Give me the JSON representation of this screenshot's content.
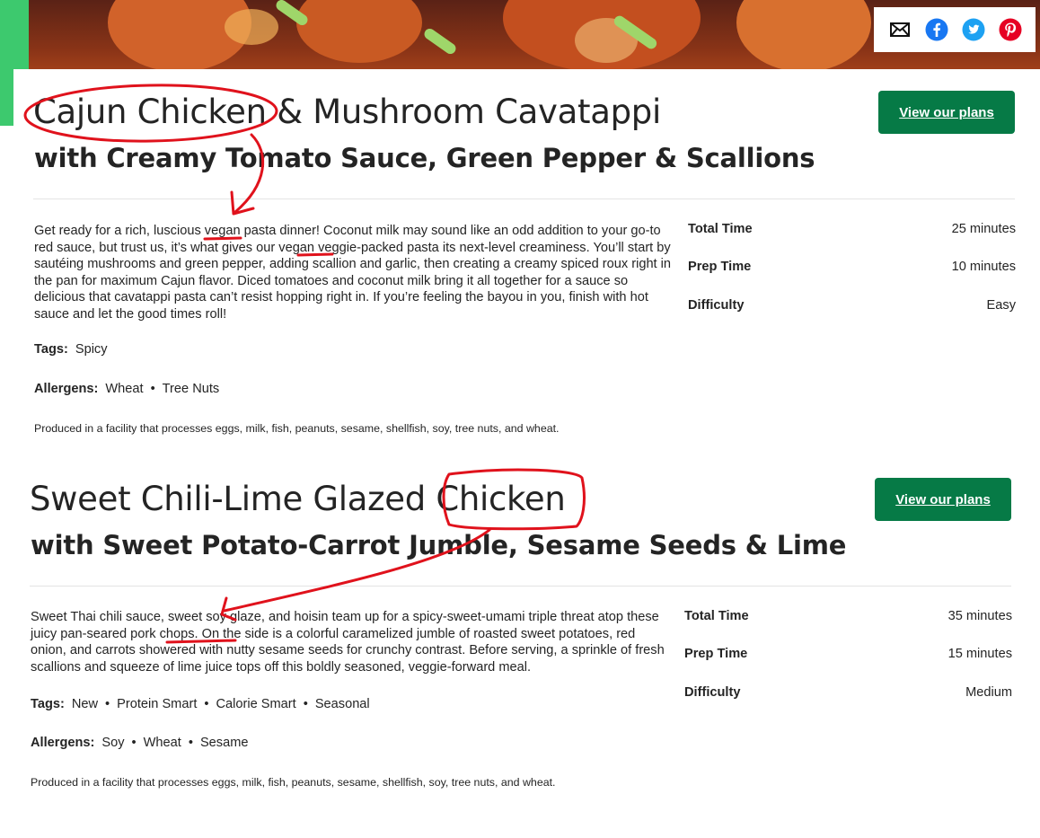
{
  "share": {
    "icons": [
      "email-icon",
      "facebook-icon",
      "twitter-icon",
      "pinterest-icon"
    ]
  },
  "recipes": [
    {
      "title": "Cajun Chicken & Mushroom Cavatappi",
      "subtitle": "with Creamy Tomato Sauce, Green Pepper & Scallions",
      "cta": "View our plans",
      "description": "Get ready for a rich, luscious vegan pasta dinner! Coconut milk may sound like an odd addition to your go-to red sauce, but trust us, it’s what gives our vegan veggie-packed pasta its next-level creaminess. You’ll start by sautéing mushrooms and green pepper, adding scallion and garlic, then creating a creamy spiced roux right in the pan for maximum Cajun flavor. Diced tomatoes and coconut milk bring it all together for a sauce so delicious that cavatappi pasta can’t resist hopping right in. If you’re feeling the bayou in you, finish with hot sauce and let the good times roll!",
      "tags_label": "Tags:",
      "tags": [
        "Spicy"
      ],
      "allergens_label": "Allergens:",
      "allergens": [
        "Wheat",
        "Tree Nuts"
      ],
      "facility": "Produced in a facility that processes eggs, milk, fish, peanuts, sesame, shellfish, soy, tree nuts, and wheat.",
      "stats": [
        {
          "label": "Total Time",
          "value": "25 minutes"
        },
        {
          "label": "Prep Time",
          "value": "10 minutes"
        },
        {
          "label": "Difficulty",
          "value": "Easy"
        }
      ]
    },
    {
      "title": "Sweet Chili-Lime Glazed Chicken",
      "subtitle": "with Sweet Potato-Carrot Jumble, Sesame Seeds & Lime",
      "cta": "View our plans",
      "description": "Sweet Thai chili sauce, sweet soy glaze, and hoisin team up for a spicy-sweet-umami triple threat atop these juicy pan-seared pork chops. On the side is a colorful caramelized jumble of roasted sweet potatoes, red onion, and carrots showered with nutty sesame seeds for crunchy contrast. Before serving, a sprinkle of fresh scallions and squeeze of lime juice tops off this boldly seasoned, veggie-forward meal.",
      "tags_label": "Tags:",
      "tags": [
        "New",
        "Protein Smart",
        "Calorie Smart",
        "Seasonal"
      ],
      "allergens_label": "Allergens:",
      "allergens": [
        "Soy",
        "Wheat",
        "Sesame"
      ],
      "facility": "Produced in a facility that processes eggs, milk, fish, peanuts, sesame, shellfish, soy, tree nuts, and wheat.",
      "stats": [
        {
          "label": "Total Time",
          "value": "35 minutes"
        },
        {
          "label": "Prep Time",
          "value": "15 minutes"
        },
        {
          "label": "Difficulty",
          "value": "Medium"
        }
      ]
    }
  ],
  "colors": {
    "cta": "#067a46",
    "annotation": "#e0121c",
    "share_facebook": "#1877f2",
    "share_twitter": "#1da1f2",
    "share_pinterest": "#e60023"
  }
}
